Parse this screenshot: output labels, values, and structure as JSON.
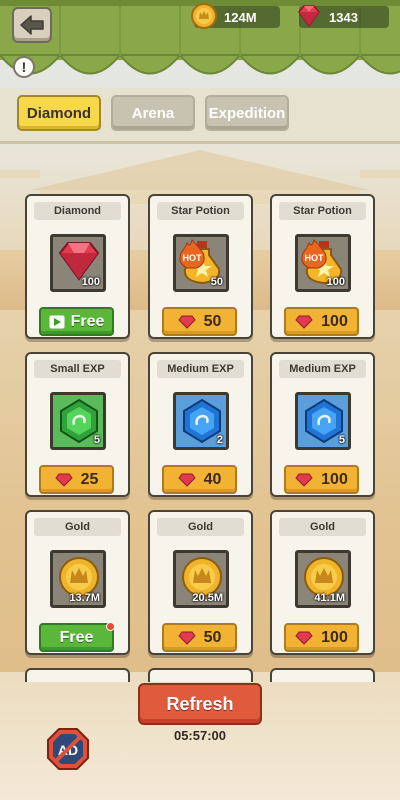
{
  "currencies": {
    "gold": "124M",
    "gems": "1343"
  },
  "tabs": [
    {
      "label": "Diamond",
      "active": true
    },
    {
      "label": "Arena",
      "active": false
    },
    {
      "label": "Expedition",
      "active": false
    }
  ],
  "shop_items": [
    {
      "name": "Diamond",
      "item_icon": "diamond-icon",
      "quantity": "100",
      "price": "Free",
      "free": true
    },
    {
      "name": "Star Potion",
      "item_icon": "potion-icon",
      "quantity": "50",
      "price": "50",
      "hot": "HOT"
    },
    {
      "name": "Star Potion",
      "item_icon": "potion-icon",
      "quantity": "100",
      "price": "100",
      "hot": "HOT"
    },
    {
      "name": "Small EXP",
      "item_icon": "green-exp-gem-icon",
      "quantity": "5",
      "price": "25"
    },
    {
      "name": "Medium EXP",
      "item_icon": "blue-exp-gem-icon",
      "quantity": "2",
      "price": "40"
    },
    {
      "name": "Medium EXP",
      "item_icon": "blue-exp-gem-icon",
      "quantity": "5",
      "price": "100"
    },
    {
      "name": "Gold",
      "item_icon": "gold-coin-icon",
      "quantity": "13.7M",
      "price": "Free",
      "free": true
    },
    {
      "name": "Gold",
      "item_icon": "gold-coin-icon",
      "quantity": "20.5M",
      "price": "50"
    },
    {
      "name": "Gold",
      "item_icon": "gold-coin-icon",
      "quantity": "41.1M",
      "price": "100"
    }
  ],
  "refresh": {
    "label": "Refresh",
    "timer": "05:57:00"
  },
  "no_ads_icon_text": "AD",
  "colors": {
    "tab_active": "#f7d84d",
    "price_button": "#f2b334",
    "free_button": "#5ab739",
    "refresh_button": "#e05a3c",
    "awning_green": "#8aa84a"
  }
}
